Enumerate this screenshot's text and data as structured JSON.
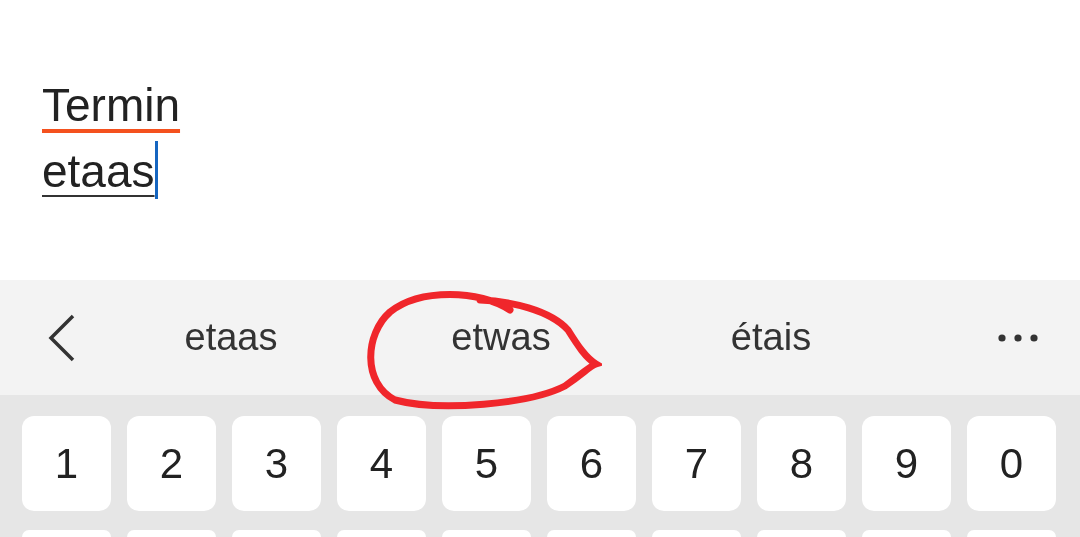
{
  "editor": {
    "lines": [
      {
        "text": "Termin",
        "kind": "misspelled"
      },
      {
        "text": "etaas",
        "kind": "composing",
        "cursor": true
      }
    ]
  },
  "suggestion_bar": {
    "suggestions": [
      {
        "text": "etaas",
        "circled": false
      },
      {
        "text": "etwas",
        "circled": true
      },
      {
        "text": "étais",
        "circled": false
      }
    ]
  },
  "keyboard": {
    "number_row": [
      "1",
      "2",
      "3",
      "4",
      "5",
      "6",
      "7",
      "8",
      "9",
      "0"
    ]
  }
}
